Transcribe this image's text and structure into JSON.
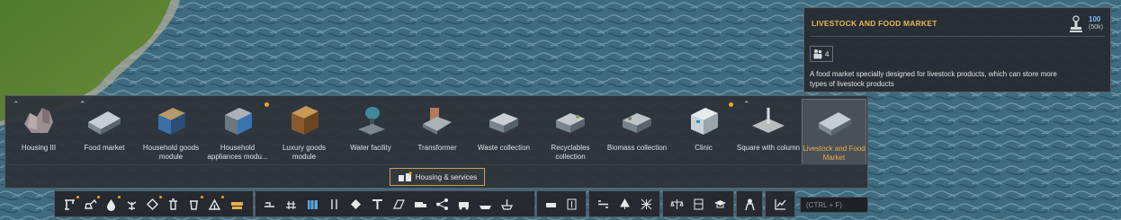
{
  "tooltip": {
    "title": "LIVESTOCK AND FOOD MARKET",
    "cost": "100",
    "cost_sub": "(50k)",
    "workers": "4",
    "description": "A food market specially designed for livestock products, which can store more types of livestock products"
  },
  "panel": {
    "items": [
      {
        "label": "Housing III"
      },
      {
        "label": "Food market"
      },
      {
        "label": "Household goods module"
      },
      {
        "label": "Household appliances modu..."
      },
      {
        "label": "Luxury goods module"
      },
      {
        "label": "Water facility"
      },
      {
        "label": "Transformer"
      },
      {
        "label": "Waste collection"
      },
      {
        "label": "Recyclables collection"
      },
      {
        "label": "Biomass collection"
      },
      {
        "label": "Clinic"
      },
      {
        "label": "Square with column"
      },
      {
        "label": "Livestock and Food Market"
      }
    ],
    "category": "Housing & services"
  },
  "search": {
    "placeholder": "(CTRL + F)"
  },
  "colors": {
    "accent": "#e9ad4d",
    "dot": "#f0a12a",
    "cost": "#7fb8ff"
  }
}
